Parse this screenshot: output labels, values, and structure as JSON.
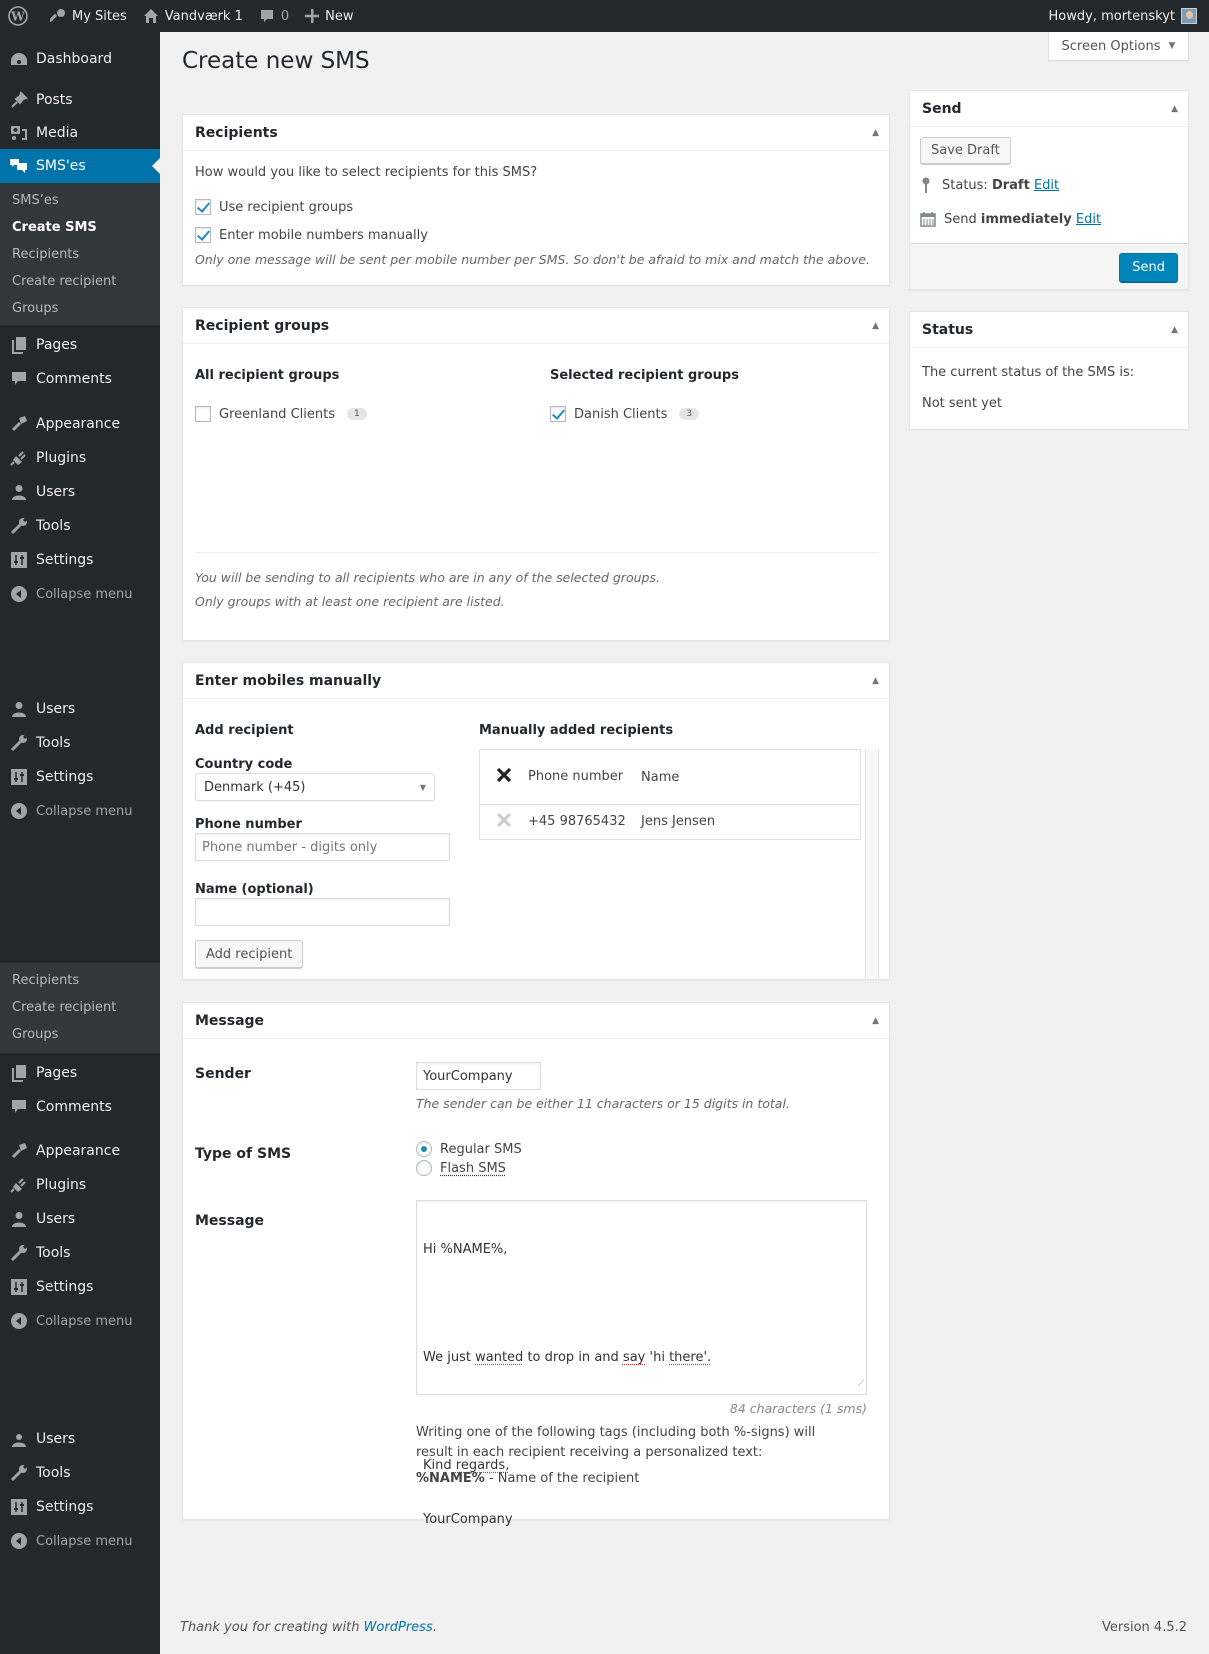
{
  "admin_bar": {
    "wp_logo": "wordpress-logo-icon",
    "my_sites": "My Sites",
    "site_name": "Vandværk 1",
    "comments_count": "0",
    "new": "New",
    "howdy": "Howdy, mortenskyt"
  },
  "sidebar": {
    "dashboard": "Dashboard",
    "posts": "Posts",
    "media": "Media",
    "smses": "SMS'es",
    "submenu": [
      "SMS’es",
      "Create SMS",
      "Recipients",
      "Create recipient",
      "Groups"
    ],
    "pages": "Pages",
    "comments": "Comments",
    "appearance": "Appearance",
    "plugins": "Plugins",
    "users": "Users",
    "tools": "Tools",
    "settings": "Settings",
    "collapse": "Collapse menu",
    "repeat_submenu": [
      "Recipients",
      "Create recipient",
      "Groups"
    ]
  },
  "page": {
    "title": "Create new SMS",
    "screen_options": "Screen Options"
  },
  "recipients_box": {
    "title": "Recipients",
    "question": "How would you like to select recipients for this SMS?",
    "options": [
      {
        "label": "Use recipient groups",
        "checked": true
      },
      {
        "label": "Enter mobile numbers manually",
        "checked": true
      }
    ],
    "note": "Only one message will be sent per mobile number per SMS. So don't be afraid to mix and match the above."
  },
  "groups_box": {
    "title": "Recipient groups",
    "all_heading": "All recipient groups",
    "selected_heading": "Selected recipient groups",
    "all_groups": [
      {
        "name": "Greenland Clients",
        "count": "1",
        "checked": false
      }
    ],
    "selected_groups": [
      {
        "name": "Danish Clients",
        "count": "3",
        "checked": true
      }
    ],
    "note1": "You will be sending to all recipients who are in any of the selected groups.",
    "note2": "Only groups with at least one recipient are listed."
  },
  "manual_box": {
    "title": "Enter mobiles manually",
    "add_heading": "Add recipient",
    "country_label": "Country code",
    "country_value": "Denmark (+45)",
    "phone_label": "Phone number",
    "phone_placeholder": "Phone number - digits only",
    "phone_value": "",
    "name_label": "Name (optional)",
    "name_value": "",
    "add_button": "Add recipient",
    "list_heading": "Manually added recipients",
    "columns": [
      "Phone number",
      "Name"
    ],
    "rows": [
      {
        "phone": "+45 98765432",
        "name": "Jens Jensen"
      }
    ]
  },
  "message_box": {
    "title": "Message",
    "sender_label": "Sender",
    "sender_value": "YourCompany",
    "sender_hint": "The sender can be either 11 characters or 15 digits in total.",
    "type_label": "Type of SMS",
    "types": [
      {
        "label": "Regular SMS",
        "checked": true
      },
      {
        "label": "Flash SMS",
        "checked": false
      }
    ],
    "message_label": "Message",
    "message_lines": [
      "Hi %NAME%,",
      "",
      "We just wanted to drop in and say 'hi there'.",
      "",
      "Kind regards,",
      "YourCompany"
    ],
    "char_count": "84 characters (1 sms)",
    "tags_help": "Writing one of the following tags (including both %-signs) will result in each recipient receiving a personalized text:",
    "tag_name": "%NAME%",
    "tag_desc": " - Name of the recipient"
  },
  "send_box": {
    "title": "Send",
    "save_draft": "Save Draft",
    "status_prefix": "Status: ",
    "status_value": "Draft",
    "edit": "Edit",
    "send_prefix": "Send ",
    "send_value": "immediately",
    "send_button": "Send"
  },
  "status_box": {
    "title": "Status",
    "text": "The current status of the SMS is:",
    "value": "Not sent yet"
  },
  "footer": {
    "thanks_prefix": "Thank you for creating with ",
    "thanks_link": "WordPress",
    "thanks_suffix": ".",
    "version": "Version 4.5.2"
  },
  "colors": {
    "accent": "#0073aa",
    "primary_button": "#0085ba",
    "sidebar_bg": "#23282d",
    "submenu_bg": "#32373c"
  }
}
